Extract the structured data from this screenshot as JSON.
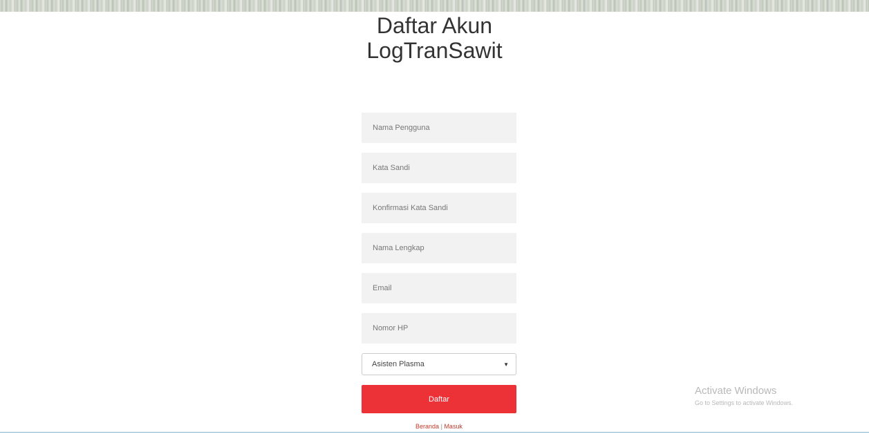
{
  "page": {
    "title_line1": "Daftar Akun",
    "title_line2": "LogTranSawit"
  },
  "form": {
    "fields": [
      {
        "name": "username",
        "placeholder": "Nama Pengguna"
      },
      {
        "name": "password",
        "placeholder": "Kata Sandi"
      },
      {
        "name": "confirm_password",
        "placeholder": "Konfirmasi Kata Sandi"
      },
      {
        "name": "full_name",
        "placeholder": "Nama Lengkap"
      },
      {
        "name": "email",
        "placeholder": "Email"
      },
      {
        "name": "phone",
        "placeholder": "Nomor HP"
      }
    ],
    "role_select": {
      "selected": "Asisten Plasma",
      "caret_icon": "chevron-down-icon"
    },
    "submit_label": "Daftar",
    "submit_color": "#ec3137"
  },
  "footer_links": {
    "home": "Beranda",
    "separator": "|",
    "login": "Masuk"
  },
  "watermark": {
    "title": "Activate Windows",
    "subtitle": "Go to Settings to activate Windows."
  }
}
